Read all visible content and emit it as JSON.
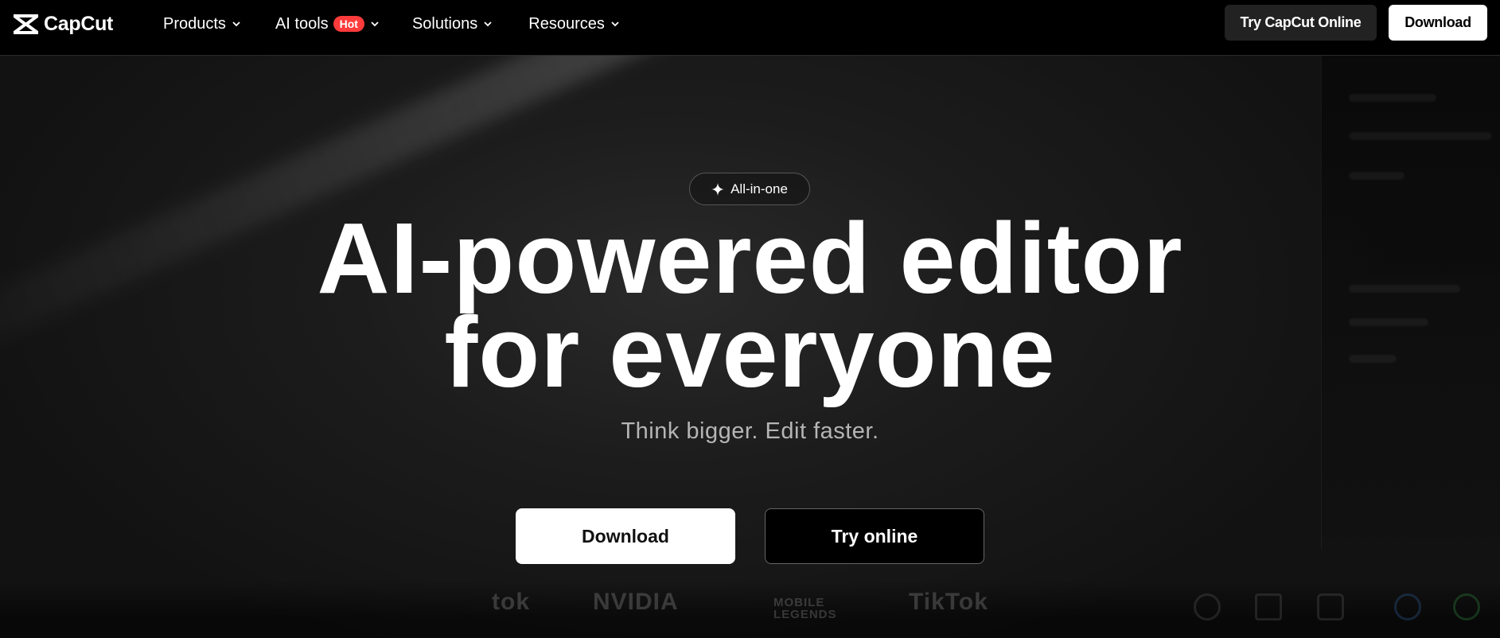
{
  "brand": {
    "name": "CapCut"
  },
  "nav": {
    "menu": [
      {
        "label": "Products",
        "badge": ""
      },
      {
        "label": "AI tools",
        "badge": "Hot"
      },
      {
        "label": "Solutions",
        "badge": ""
      },
      {
        "label": "Resources",
        "badge": ""
      }
    ],
    "try_online_label": "Try CapCut Online",
    "download_label": "Download"
  },
  "hero": {
    "pill_label": "All-in-one",
    "headline_line1": "AI-powered editor",
    "headline_line2": "for everyone",
    "subtitle": "Think bigger. Edit faster.",
    "download_label": "Download",
    "try_online_label": "Try online"
  },
  "partners": [
    "tok",
    "NVIDIA",
    "MOBILE LEGENDS",
    "TikTok"
  ],
  "colors": {
    "background": "#000000",
    "hot_badge": "#ff3b3b",
    "primary_button": "#ffffff"
  }
}
